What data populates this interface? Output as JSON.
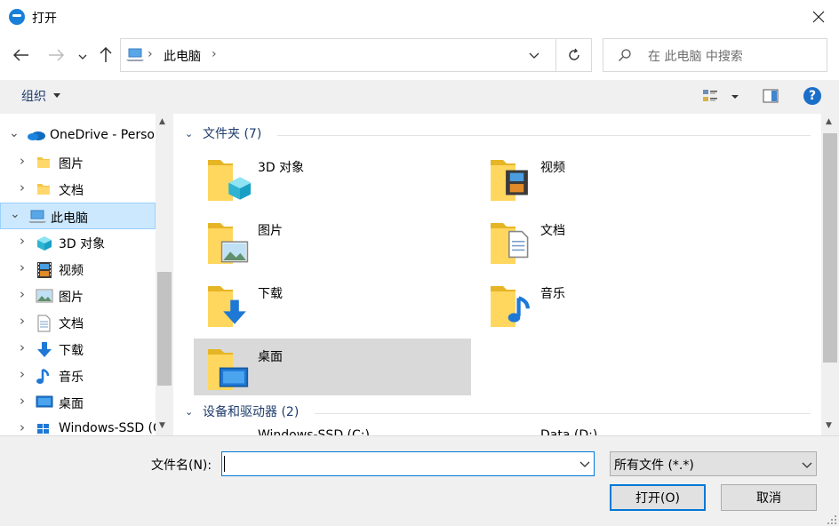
{
  "window": {
    "title": "打开"
  },
  "address": {
    "path": "此电脑"
  },
  "search": {
    "placeholder": "在 此电脑 中搜索"
  },
  "toolbar": {
    "organize": "组织",
    "help": "?"
  },
  "nav": {
    "items": [
      {
        "label": "OneDrive - Perso",
        "icon": "onedrive-icon",
        "level": 0,
        "expanded": true
      },
      {
        "label": "图片",
        "icon": "folder-icon",
        "level": 1
      },
      {
        "label": "文档",
        "icon": "folder-icon",
        "level": 1
      },
      {
        "label": "此电脑",
        "icon": "pc-icon",
        "level": 0,
        "expanded": true,
        "selected": true
      },
      {
        "label": "3D 对象",
        "icon": "cube-icon",
        "level": 1
      },
      {
        "label": "视频",
        "icon": "film-icon",
        "level": 1
      },
      {
        "label": "图片",
        "icon": "picture-icon",
        "level": 1
      },
      {
        "label": "文档",
        "icon": "document-icon",
        "level": 1
      },
      {
        "label": "下载",
        "icon": "download-icon",
        "level": 1
      },
      {
        "label": "音乐",
        "icon": "music-note-icon",
        "level": 1
      },
      {
        "label": "桌面",
        "icon": "desktop-icon",
        "level": 1
      },
      {
        "label": "Windows-SSD (C",
        "icon": "drive-icon",
        "level": 1
      }
    ]
  },
  "content": {
    "folders_header": "文件夹 (7)",
    "devices_header": "设备和驱动器 (2)",
    "folders": [
      {
        "label": "3D 对象",
        "icon": "cube-icon"
      },
      {
        "label": "视频",
        "icon": "film-icon"
      },
      {
        "label": "图片",
        "icon": "picture-icon"
      },
      {
        "label": "文档",
        "icon": "document-icon"
      },
      {
        "label": "下载",
        "icon": "download-icon"
      },
      {
        "label": "音乐",
        "icon": "music-note-icon"
      },
      {
        "label": "桌面",
        "icon": "desktop-icon",
        "selected": true
      }
    ],
    "drives": [
      {
        "label": "Windows-SSD (C:)"
      },
      {
        "label": "Data (D:)"
      }
    ]
  },
  "bottom": {
    "filename_label": "文件名(N):",
    "filename_value": "",
    "filter": "所有文件 (*.*)",
    "open": "打开(O)",
    "cancel": "取消"
  },
  "colors": {
    "accent": "#0078d7",
    "selection": "#cce8ff",
    "tile_selected": "#d9d9d9"
  }
}
